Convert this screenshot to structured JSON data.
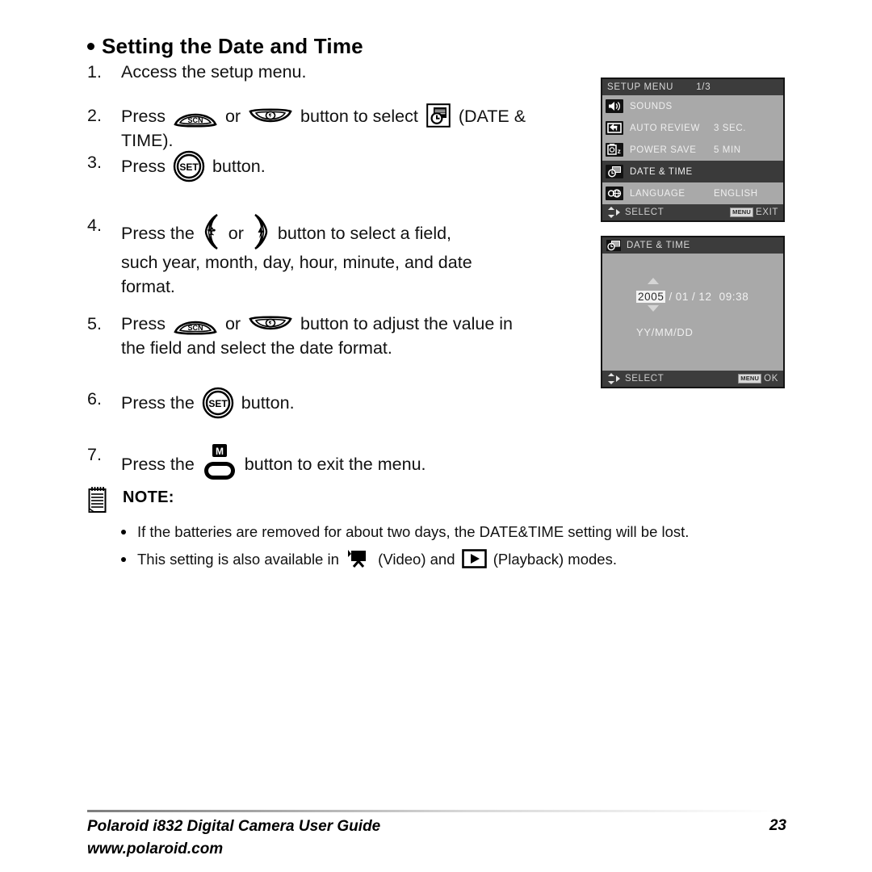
{
  "heading": "Setting the Date and Time",
  "steps": {
    "s1": {
      "num": "1.",
      "text": "Access the setup menu."
    },
    "s2": {
      "num": "2.",
      "pre": "Press",
      "mid": "or",
      "post": "button to select",
      "paren_open": "(DATE &",
      "line2": "TIME)."
    },
    "s3": {
      "num": "3.",
      "pre": "Press",
      "post": "button."
    },
    "s4": {
      "num": "4.",
      "pre": "Press the",
      "mid": "or",
      "post": "button to select a field,",
      "line2": "such year, month, day, hour, minute, and date",
      "line3": "format."
    },
    "s5": {
      "num": "5.",
      "pre": "Press",
      "mid": "or",
      "post": "button to adjust the value in",
      "line2": "the field and select the date format."
    },
    "s6": {
      "num": "6.",
      "pre": "Press  the",
      "post": "button."
    },
    "s7": {
      "num": "7.",
      "pre": "Press the",
      "post": "button to exit the menu."
    }
  },
  "note": {
    "title": "NOTE:",
    "items": [
      {
        "text": "If the batteries are removed for about two days, the DATE&TIME setting will be lost."
      }
    ],
    "item2": {
      "pre": "This setting is also available in",
      "mid": "(Video) and",
      "post": "(Playback) modes."
    }
  },
  "setup_menu": {
    "title": "SETUP MENU",
    "page": "1/3",
    "rows": [
      {
        "icon": "speaker-icon",
        "label": "SOUNDS",
        "value": ""
      },
      {
        "icon": "auto-review-icon",
        "label": "AUTO REVIEW",
        "value": "3 SEC."
      },
      {
        "icon": "power-save-icon",
        "label": "POWER SAVE",
        "value": "5 MIN"
      },
      {
        "icon": "date-time-icon",
        "label": "DATE & TIME",
        "value": ""
      },
      {
        "icon": "language-icon",
        "label": "LANGUAGE",
        "value": "ENGLISH"
      }
    ],
    "selected_index": 3,
    "footer_select": "SELECT",
    "footer_badge": "MENU",
    "footer_action": "EXIT"
  },
  "date_time_screen": {
    "title": "DATE & TIME",
    "year": "2005",
    "month": "01",
    "day": "12",
    "time": "09:38",
    "separator": "/",
    "format": "YY/MM/DD",
    "footer_select": "SELECT",
    "footer_badge": "MENU",
    "footer_action": "OK"
  },
  "footer": {
    "line1": "Polaroid i832 Digital Camera User Guide",
    "line2": "www.polaroid.com",
    "page_number": "23"
  },
  "colors": {
    "lcd_background": "#a9a9a9",
    "lcd_bar": "#3c3c3c",
    "lcd_border": "#141414",
    "highlight_row": "#3a3a3a",
    "text_light": "#efefef"
  }
}
